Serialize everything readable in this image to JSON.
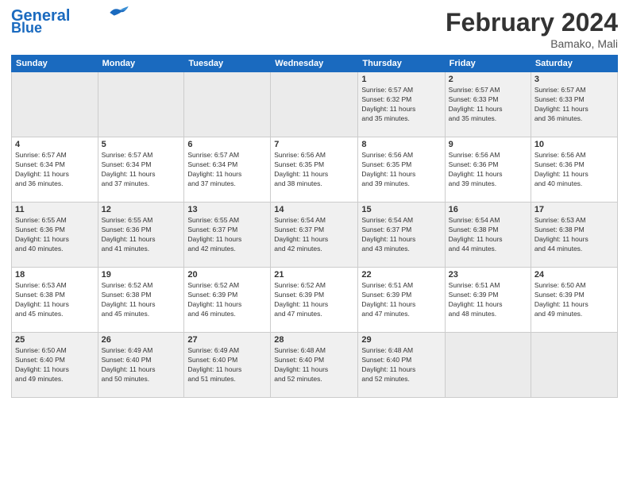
{
  "header": {
    "logo_line1": "General",
    "logo_line2": "Blue",
    "month_title": "February 2024",
    "location": "Bamako, Mali"
  },
  "weekdays": [
    "Sunday",
    "Monday",
    "Tuesday",
    "Wednesday",
    "Thursday",
    "Friday",
    "Saturday"
  ],
  "weeks": [
    [
      {
        "day": "",
        "info": ""
      },
      {
        "day": "",
        "info": ""
      },
      {
        "day": "",
        "info": ""
      },
      {
        "day": "",
        "info": ""
      },
      {
        "day": "1",
        "info": "Sunrise: 6:57 AM\nSunset: 6:32 PM\nDaylight: 11 hours\nand 35 minutes."
      },
      {
        "day": "2",
        "info": "Sunrise: 6:57 AM\nSunset: 6:33 PM\nDaylight: 11 hours\nand 35 minutes."
      },
      {
        "day": "3",
        "info": "Sunrise: 6:57 AM\nSunset: 6:33 PM\nDaylight: 11 hours\nand 36 minutes."
      }
    ],
    [
      {
        "day": "4",
        "info": "Sunrise: 6:57 AM\nSunset: 6:34 PM\nDaylight: 11 hours\nand 36 minutes."
      },
      {
        "day": "5",
        "info": "Sunrise: 6:57 AM\nSunset: 6:34 PM\nDaylight: 11 hours\nand 37 minutes."
      },
      {
        "day": "6",
        "info": "Sunrise: 6:57 AM\nSunset: 6:34 PM\nDaylight: 11 hours\nand 37 minutes."
      },
      {
        "day": "7",
        "info": "Sunrise: 6:56 AM\nSunset: 6:35 PM\nDaylight: 11 hours\nand 38 minutes."
      },
      {
        "day": "8",
        "info": "Sunrise: 6:56 AM\nSunset: 6:35 PM\nDaylight: 11 hours\nand 39 minutes."
      },
      {
        "day": "9",
        "info": "Sunrise: 6:56 AM\nSunset: 6:36 PM\nDaylight: 11 hours\nand 39 minutes."
      },
      {
        "day": "10",
        "info": "Sunrise: 6:56 AM\nSunset: 6:36 PM\nDaylight: 11 hours\nand 40 minutes."
      }
    ],
    [
      {
        "day": "11",
        "info": "Sunrise: 6:55 AM\nSunset: 6:36 PM\nDaylight: 11 hours\nand 40 minutes."
      },
      {
        "day": "12",
        "info": "Sunrise: 6:55 AM\nSunset: 6:36 PM\nDaylight: 11 hours\nand 41 minutes."
      },
      {
        "day": "13",
        "info": "Sunrise: 6:55 AM\nSunset: 6:37 PM\nDaylight: 11 hours\nand 42 minutes."
      },
      {
        "day": "14",
        "info": "Sunrise: 6:54 AM\nSunset: 6:37 PM\nDaylight: 11 hours\nand 42 minutes."
      },
      {
        "day": "15",
        "info": "Sunrise: 6:54 AM\nSunset: 6:37 PM\nDaylight: 11 hours\nand 43 minutes."
      },
      {
        "day": "16",
        "info": "Sunrise: 6:54 AM\nSunset: 6:38 PM\nDaylight: 11 hours\nand 44 minutes."
      },
      {
        "day": "17",
        "info": "Sunrise: 6:53 AM\nSunset: 6:38 PM\nDaylight: 11 hours\nand 44 minutes."
      }
    ],
    [
      {
        "day": "18",
        "info": "Sunrise: 6:53 AM\nSunset: 6:38 PM\nDaylight: 11 hours\nand 45 minutes."
      },
      {
        "day": "19",
        "info": "Sunrise: 6:52 AM\nSunset: 6:38 PM\nDaylight: 11 hours\nand 45 minutes."
      },
      {
        "day": "20",
        "info": "Sunrise: 6:52 AM\nSunset: 6:39 PM\nDaylight: 11 hours\nand 46 minutes."
      },
      {
        "day": "21",
        "info": "Sunrise: 6:52 AM\nSunset: 6:39 PM\nDaylight: 11 hours\nand 47 minutes."
      },
      {
        "day": "22",
        "info": "Sunrise: 6:51 AM\nSunset: 6:39 PM\nDaylight: 11 hours\nand 47 minutes."
      },
      {
        "day": "23",
        "info": "Sunrise: 6:51 AM\nSunset: 6:39 PM\nDaylight: 11 hours\nand 48 minutes."
      },
      {
        "day": "24",
        "info": "Sunrise: 6:50 AM\nSunset: 6:39 PM\nDaylight: 11 hours\nand 49 minutes."
      }
    ],
    [
      {
        "day": "25",
        "info": "Sunrise: 6:50 AM\nSunset: 6:40 PM\nDaylight: 11 hours\nand 49 minutes."
      },
      {
        "day": "26",
        "info": "Sunrise: 6:49 AM\nSunset: 6:40 PM\nDaylight: 11 hours\nand 50 minutes."
      },
      {
        "day": "27",
        "info": "Sunrise: 6:49 AM\nSunset: 6:40 PM\nDaylight: 11 hours\nand 51 minutes."
      },
      {
        "day": "28",
        "info": "Sunrise: 6:48 AM\nSunset: 6:40 PM\nDaylight: 11 hours\nand 52 minutes."
      },
      {
        "day": "29",
        "info": "Sunrise: 6:48 AM\nSunset: 6:40 PM\nDaylight: 11 hours\nand 52 minutes."
      },
      {
        "day": "",
        "info": ""
      },
      {
        "day": "",
        "info": ""
      }
    ]
  ]
}
